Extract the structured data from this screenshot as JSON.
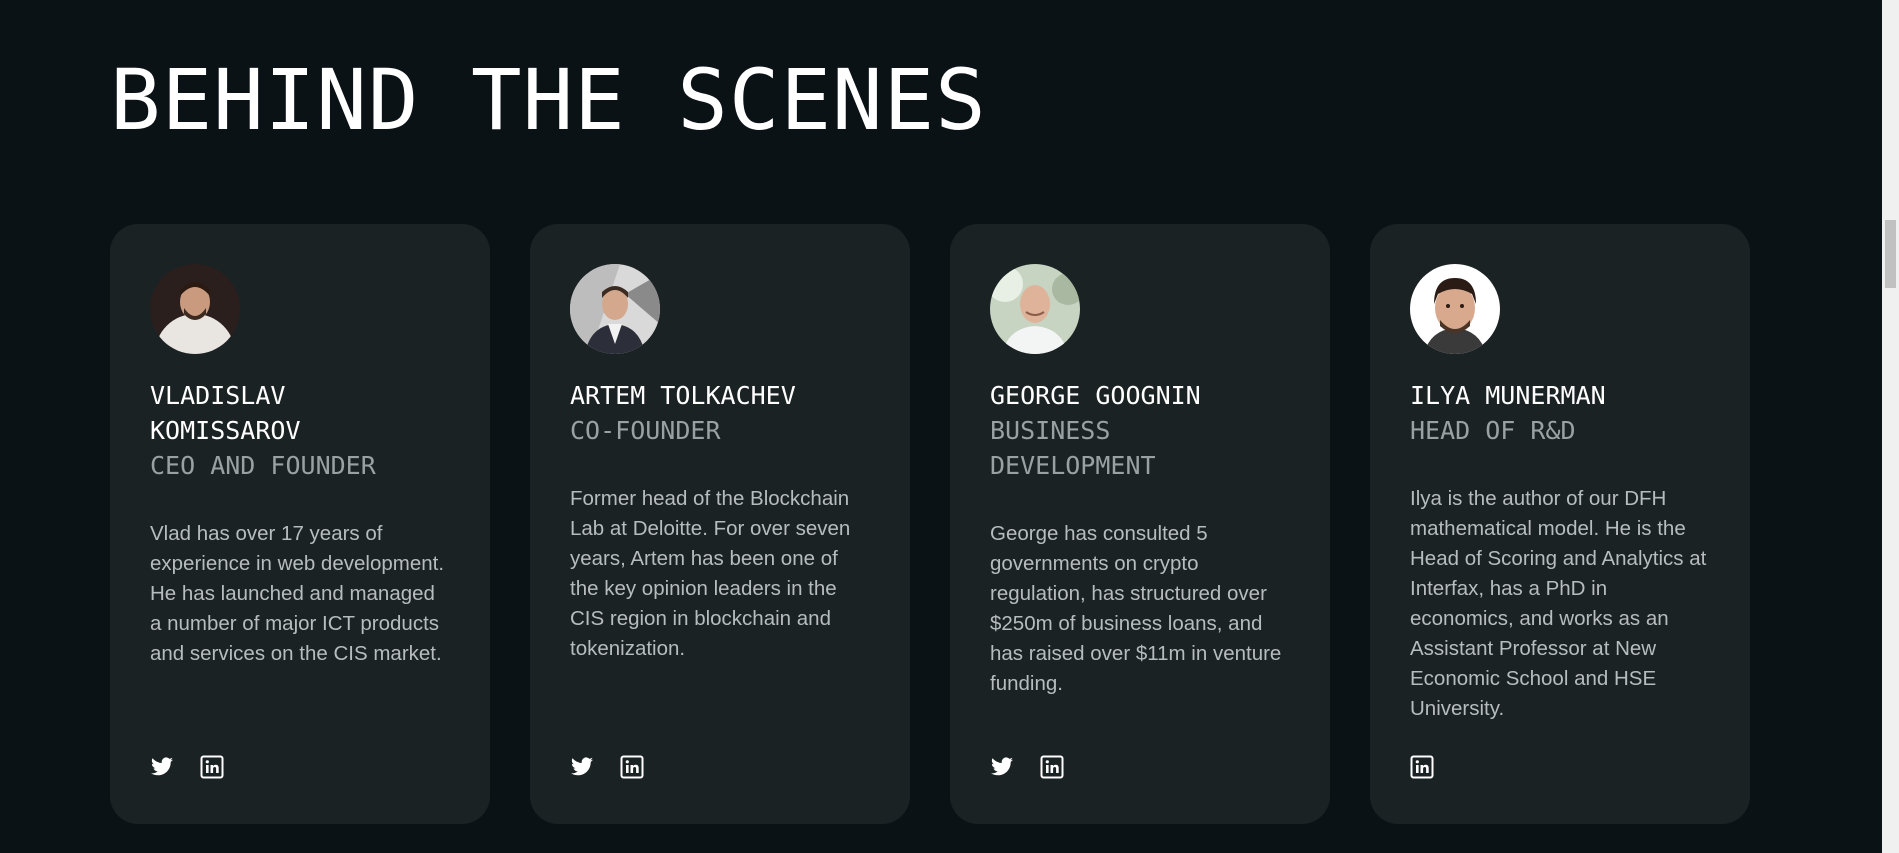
{
  "section": {
    "title": "BEHIND THE SCENES"
  },
  "team": [
    {
      "name": "VLADISLAV KOMISSAROV",
      "role": "CEO AND FOUNDER",
      "bio": "Vlad has over 17 years of experience in web development. He has launched and managed a number of major ICT products and services on the CIS market.",
      "socials": [
        "twitter-icon",
        "linkedin-icon"
      ]
    },
    {
      "name": "ARTEM TOLKACHEV",
      "role": "CO-FOUNDER",
      "bio": "Former head of the Blockchain Lab at Deloitte. For over seven years, Artem has been one of the key opinion leaders in the CIS region in blockchain and tokenization.",
      "socials": [
        "twitter-icon",
        "linkedin-icon"
      ]
    },
    {
      "name": "GEORGE GOOGNIN",
      "role": "BUSINESS DEVELOPMENT",
      "bio": "George has consulted 5 governments on crypto regulation, has structured over $250m of business loans, and has raised over $11m in venture funding.",
      "socials": [
        "twitter-icon",
        "linkedin-icon"
      ]
    },
    {
      "name": "ILYA MUNERMAN",
      "role": "HEAD OF R&D",
      "bio": "Ilya is the author of our DFH mathematical model. He is the Head of Scoring and Analytics at Interfax, has a PhD in economics, and works as an Assistant Professor at New Economic School and HSE University.",
      "socials": [
        "linkedin-icon"
      ]
    }
  ],
  "colors": {
    "background": "#0b1215",
    "card": "#1b2224",
    "text_primary": "#ffffff",
    "text_secondary": "#9aa1a3",
    "text_body": "#b7bcbe"
  }
}
